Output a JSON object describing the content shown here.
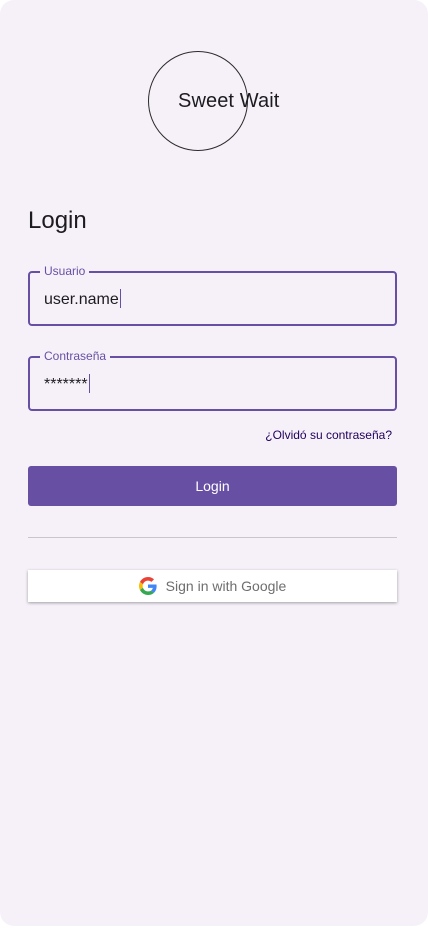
{
  "app": {
    "logo_text": "Sweet Wait"
  },
  "login": {
    "heading": "Login",
    "username": {
      "label": "Usuario",
      "value": "user.name"
    },
    "password": {
      "label": "Contraseña",
      "value": "*******"
    },
    "forgot_link": "¿Olvidó su contraseña?",
    "submit_label": "Login",
    "google_label": "Sign in with Google"
  },
  "colors": {
    "primary": "#6750a4",
    "background": "#f6f1f9",
    "link": "#21005d",
    "divider": "#cac4d0"
  },
  "icons": {
    "google": "google-g-icon"
  }
}
